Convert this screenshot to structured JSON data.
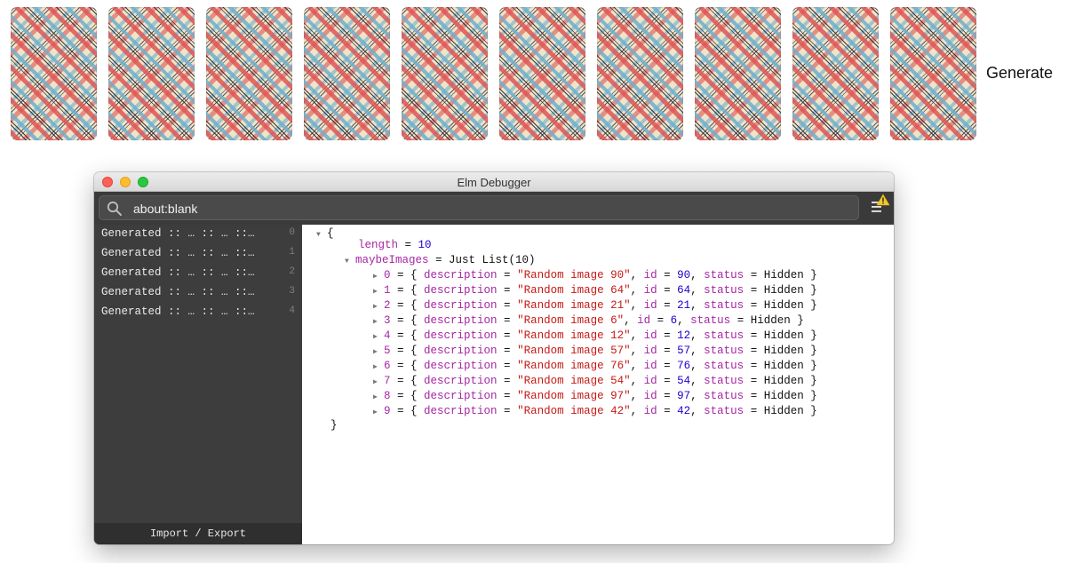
{
  "cards": {
    "count": 10,
    "pattern": "plaid-card-back",
    "colors": {
      "base": "#efe3c8",
      "red": "#de5656",
      "dark": "#282837",
      "blue": "#6eafcd"
    }
  },
  "generate_label": "Generate",
  "debugger": {
    "window_title": "Elm Debugger",
    "address": "about:blank",
    "menu_icon": "hamburger-menu-icon",
    "warning_icon": "warning-triangle-icon",
    "messages": [
      {
        "text": "Generated :: … :: … ::…",
        "index": "0"
      },
      {
        "text": "Generated :: … :: … ::…",
        "index": "1"
      },
      {
        "text": "Generated :: … :: … ::…",
        "index": "2"
      },
      {
        "text": "Generated :: … :: … ::…",
        "index": "3"
      },
      {
        "text": "Generated :: … :: … ::…",
        "index": "4"
      }
    ],
    "footer_label": "Import / Export",
    "model": {
      "open_brace": "{",
      "close_brace": "}",
      "length_field": "length",
      "length_value": "10",
      "maybe_field": "maybeImages",
      "maybe_value": "Just List(10)",
      "desc_field": "description",
      "id_field": "id",
      "status_field": "status",
      "items": [
        {
          "index": "0",
          "description": "\"Random image 90\"",
          "id": "90",
          "status": "Hidden"
        },
        {
          "index": "1",
          "description": "\"Random image 64\"",
          "id": "64",
          "status": "Hidden"
        },
        {
          "index": "2",
          "description": "\"Random image 21\"",
          "id": "21",
          "status": "Hidden"
        },
        {
          "index": "3",
          "description": "\"Random image 6\"",
          "id": "6",
          "status": "Hidden"
        },
        {
          "index": "4",
          "description": "\"Random image 12\"",
          "id": "12",
          "status": "Hidden"
        },
        {
          "index": "5",
          "description": "\"Random image 57\"",
          "id": "57",
          "status": "Hidden"
        },
        {
          "index": "6",
          "description": "\"Random image 76\"",
          "id": "76",
          "status": "Hidden"
        },
        {
          "index": "7",
          "description": "\"Random image 54\"",
          "id": "54",
          "status": "Hidden"
        },
        {
          "index": "8",
          "description": "\"Random image 97\"",
          "id": "97",
          "status": "Hidden"
        },
        {
          "index": "9",
          "description": "\"Random image 42\"",
          "id": "42",
          "status": "Hidden"
        }
      ]
    }
  }
}
